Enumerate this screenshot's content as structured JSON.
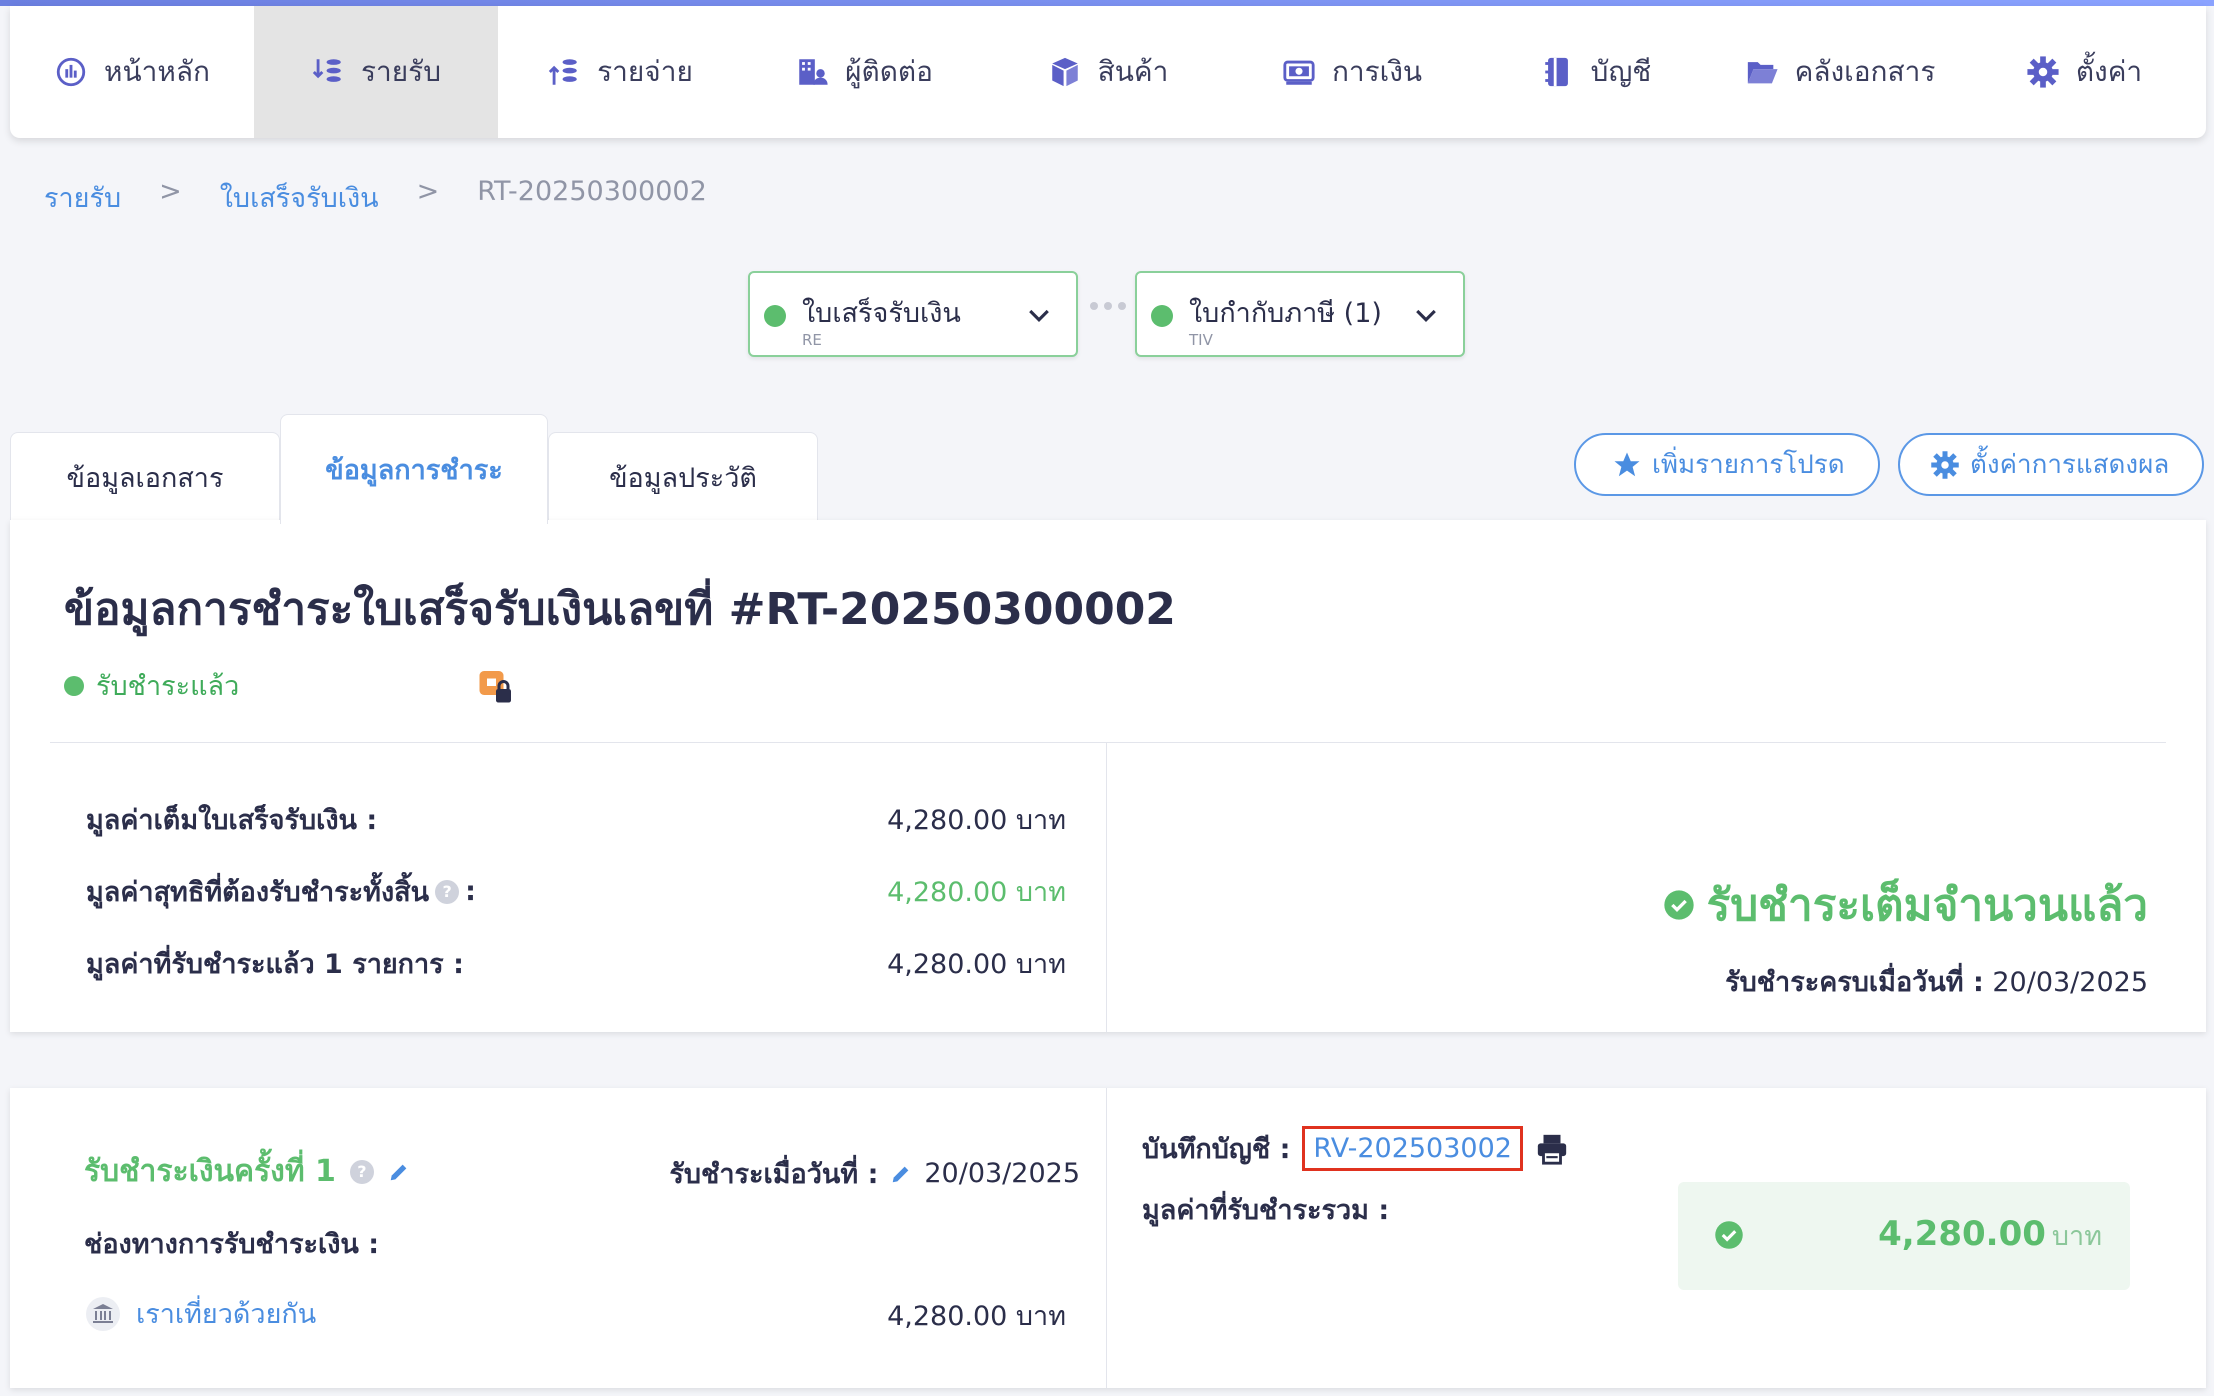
{
  "nav": {
    "items": [
      {
        "label": "หน้าหลัก",
        "icon": "dashboard-icon"
      },
      {
        "label": "รายรับ",
        "icon": "income-icon"
      },
      {
        "label": "รายจ่าย",
        "icon": "expense-icon"
      },
      {
        "label": "ผู้ติดต่อ",
        "icon": "contacts-icon"
      },
      {
        "label": "สินค้า",
        "icon": "product-box-icon"
      },
      {
        "label": "การเงิน",
        "icon": "money-icon"
      },
      {
        "label": "บัญชี",
        "icon": "account-book-icon"
      },
      {
        "label": "คลังเอกสาร",
        "icon": "folder-icon"
      },
      {
        "label": "ตั้งค่า",
        "icon": "gear-icon"
      }
    ],
    "active_index": 1
  },
  "breadcrumb": {
    "level1": "รายรับ",
    "level2": "ใบเสร็จรับเงิน",
    "current": "RT-20250300002",
    "separator": ">"
  },
  "doc_chain": [
    {
      "title": "ใบเสร็จรับเงิน",
      "code": "RE"
    },
    {
      "title": "ใบกำกับภาษี (1)",
      "code": "TIV"
    }
  ],
  "tabs": [
    {
      "label": "ข้อมูลเอกสาร"
    },
    {
      "label": "ข้อมูลการชำระ"
    },
    {
      "label": "ข้อมูลประวัติ"
    }
  ],
  "actions": {
    "favorite": "เพิ่มรายการโปรด",
    "display_settings": "ตั้งค่าการแสดงผล"
  },
  "summary": {
    "title": "ข้อมูลการชำระใบเสร็จรับเงินเลขที่ #RT-20250300002",
    "status": "รับชำระแล้ว",
    "rows": [
      {
        "label": "มูลค่าเต็มใบเสร็จรับเงิน :",
        "value": "4,280.00 บาท"
      },
      {
        "label": "มูลค่าสุทธิที่ต้องรับชำระทั้งสิ้น",
        "value": "4,280.00 บาท",
        "suffix": ":"
      },
      {
        "label": "มูลค่าที่รับชำระแล้ว 1 รายการ :",
        "value": "4,280.00 บาท"
      }
    ],
    "paid_full": "รับชำระเต็มจำนวนแล้ว",
    "paid_date_label": "รับชำระครบเมื่อวันที่ :",
    "paid_date": "20/03/2025"
  },
  "payment": {
    "title": "รับชำระเงินครั้งที่ 1",
    "date_label": "รับชำระเมื่อวันที่ :",
    "date": "20/03/2025",
    "channel_label": "ช่องทางการรับชำระเงิน :",
    "channel_name": "เราเที่ยวด้วยกัน",
    "channel_amount": "4,280.00 บาท",
    "account_label": "บันทึกบัญชี :",
    "account_ref": "RV-202503002",
    "total_label": "มูลค่าที่รับชำระรวม :",
    "total_value": "4,280.00",
    "total_unit": "บาท"
  },
  "colors": {
    "accent_blue": "#4a8de0",
    "success_green": "#5cbd6e",
    "highlight_red": "#e0321f"
  }
}
